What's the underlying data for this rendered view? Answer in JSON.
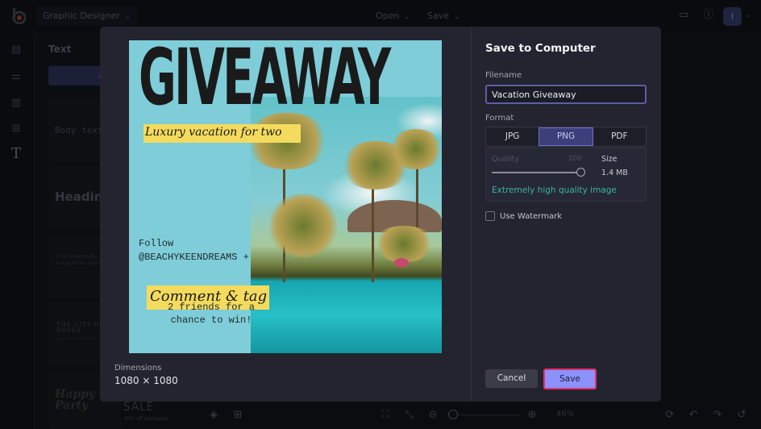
{
  "app": {
    "project_name": "Graphic Designer",
    "menus": [
      {
        "label": "Open"
      },
      {
        "label": "Save"
      }
    ],
    "avatar_initial": "I",
    "icons": {
      "logo": "befunky-logo-icon",
      "comments": "comments-icon",
      "help": "help-icon",
      "chevron": "chevron-down-icon"
    }
  },
  "rail": {
    "items": [
      {
        "icon": "templates-icon",
        "glyph": "▤"
      },
      {
        "icon": "customize-icon",
        "glyph": "⚌"
      },
      {
        "icon": "layouts-icon",
        "glyph": "▥"
      },
      {
        "icon": "graphics-icon",
        "glyph": "⊞"
      },
      {
        "icon": "text-icon",
        "glyph": "T"
      }
    ]
  },
  "panel": {
    "title": "Text",
    "add_button": "A",
    "templates": [
      {
        "label": "Body text"
      },
      {
        "label": "Heading"
      },
      {
        "label": "It is better to fly... in magnificent style"
      },
      {
        "label": "THE CITY OF ROSES",
        "sub": "Portland Oregon travel guide and city highlights"
      },
      {
        "label": "Happy Party"
      }
    ]
  },
  "canvas_bar": {
    "sale_text": "SALE",
    "sale_sub": "20% off storewide",
    "zoom_percent": "46%",
    "zoom_fraction": 0.46,
    "icons": {
      "layers": "layers-icon",
      "grid": "grid-icon",
      "fit": "fit-screen-icon",
      "actual": "actual-size-icon",
      "zoom_out": "zoom-out-icon",
      "zoom_in": "zoom-in-icon",
      "rotate": "refresh-icon",
      "undo": "undo-icon",
      "redo": "redo-icon",
      "history": "history-icon"
    }
  },
  "modal": {
    "title": "Save to Computer",
    "preview": {
      "headline": "GIVEAWAY",
      "subtitle": "Luxury vacation for two",
      "follow_line1": "Follow",
      "follow_line2": "@BEACHYKEENDREAMS +",
      "cta": "Comment & tag",
      "friends_line1": "2 friends for a",
      "friends_line2": "chance to win!"
    },
    "dimensions_label": "Dimensions",
    "dimensions_value": "1080 × 1080",
    "filename_label": "Filename",
    "filename_value": "Vacation Giveaway",
    "format_label": "Format",
    "formats": [
      {
        "label": "JPG",
        "selected": false
      },
      {
        "label": "PNG",
        "selected": true
      },
      {
        "label": "PDF",
        "selected": false
      }
    ],
    "quality_label": "Quality",
    "quality_value": "100",
    "size_label": "Size",
    "size_value": "1.4 MB",
    "quality_note": "Extremely high quality image",
    "watermark_label": "Use Watermark",
    "watermark_checked": false,
    "cancel_label": "Cancel",
    "save_label": "Save",
    "colors": {
      "accent": "#8c91fb",
      "focus_ring": "#e0336f",
      "quality_note": "#3fb3a0",
      "selected_format": "#3c3f7a"
    }
  }
}
